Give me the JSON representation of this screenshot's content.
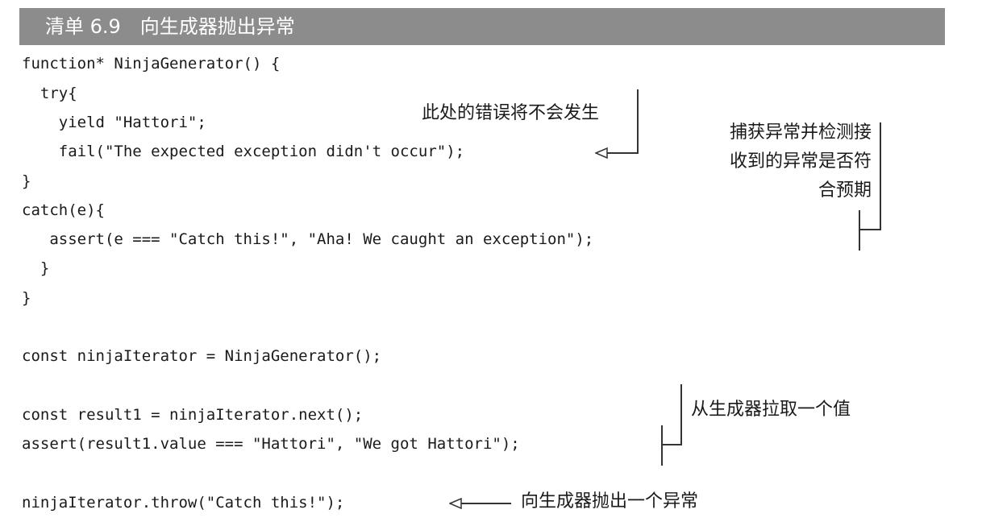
{
  "listing": {
    "title": "清单 6.9　向生成器抛出异常"
  },
  "code": [
    "function* NinjaGenerator() {",
    "  try{",
    "    yield \"Hattori\";",
    "    fail(\"The expected exception didn't occur\");",
    "}",
    "catch(e){",
    "   assert(e === \"Catch this!\", \"Aha! We caught an exception\");",
    "  }",
    "}",
    "const ninjaIterator = NinjaGenerator();",
    "const result1 = ninjaIterator.next();",
    "assert(result1.value === \"Hattori\", \"We got Hattori\");",
    "ninjaIterator.throw(\"Catch this!\");"
  ],
  "annotations": {
    "no_error": "此处的错误将不会发生",
    "catch_check": [
      "捕获异常并检测接",
      "收到的异常是否符",
      "合预期"
    ],
    "pull_value": "从生成器拉取一个值",
    "throw_exception": "向生成器抛出一个异常"
  },
  "colors": {
    "title_bar": "#8c8c8c",
    "title_text": "#ffffff",
    "text": "#1a1a1a"
  }
}
